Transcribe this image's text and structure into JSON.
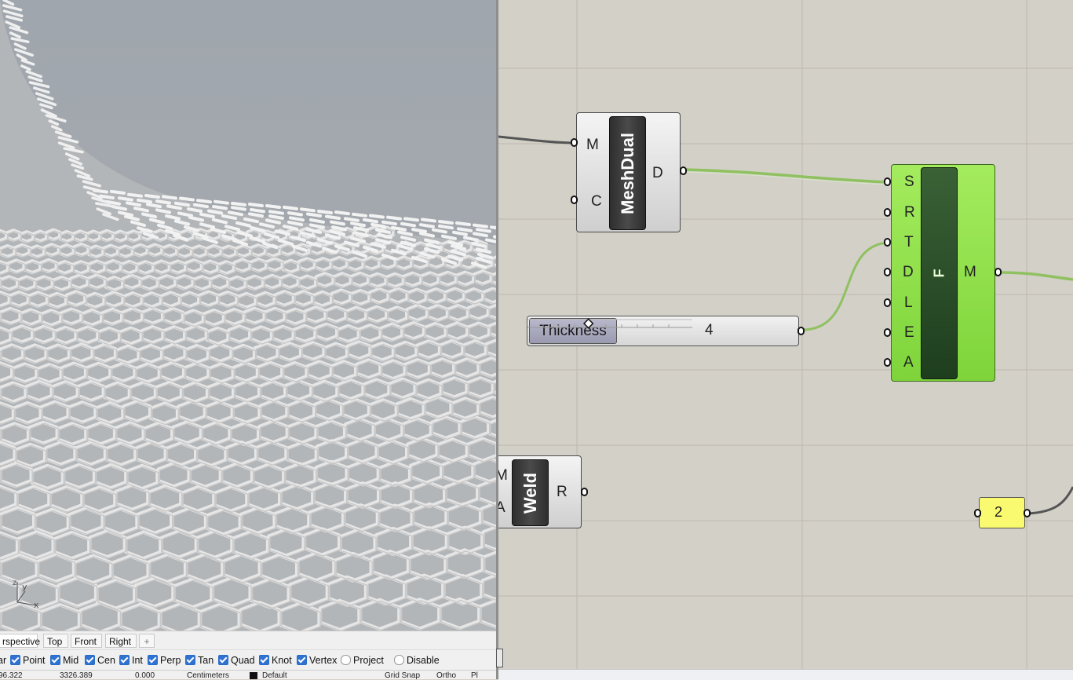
{
  "rhino": {
    "view_tabs": [
      "rspective",
      "Top",
      "Front",
      "Right"
    ],
    "add_tab_glyph": "+",
    "axis": {
      "x": "x",
      "y": "y",
      "z": "z"
    },
    "osnaps": [
      {
        "label": "ar",
        "checked": null
      },
      {
        "label": "Point",
        "checked": true
      },
      {
        "label": "Mid",
        "checked": true
      },
      {
        "label": "Cen",
        "checked": true
      },
      {
        "label": "Int",
        "checked": true
      },
      {
        "label": "Perp",
        "checked": true
      },
      {
        "label": "Tan",
        "checked": true
      },
      {
        "label": "Quad",
        "checked": true
      },
      {
        "label": "Knot",
        "checked": true
      },
      {
        "label": "Vertex",
        "checked": true
      },
      {
        "label": "Project",
        "checked": false
      },
      {
        "label": "Disable",
        "checked": false
      }
    ],
    "status": [
      "96.322",
      "3326.389",
      "0.000",
      "Centimeters",
      "Default",
      "Grid Snap",
      "Ortho",
      "Pl"
    ]
  },
  "grasshopper": {
    "meshdual": {
      "nickname": "MeshDual",
      "inputs": [
        "M",
        "C"
      ],
      "outputs": [
        "D"
      ]
    },
    "frame": {
      "nickname": "F",
      "inputs": [
        "S",
        "R",
        "T",
        "D",
        "L",
        "E",
        "A"
      ],
      "outputs": [
        "M"
      ],
      "color": "#8fe04a"
    },
    "weld": {
      "nickname": "Weld",
      "inputs": [
        "M",
        "A"
      ],
      "outputs": [
        "R"
      ]
    },
    "slider": {
      "name": "Thickness",
      "value": "4",
      "value_fraction": 0.37
    },
    "panel": {
      "value": "2"
    },
    "wire_color": "#7fc24a"
  }
}
